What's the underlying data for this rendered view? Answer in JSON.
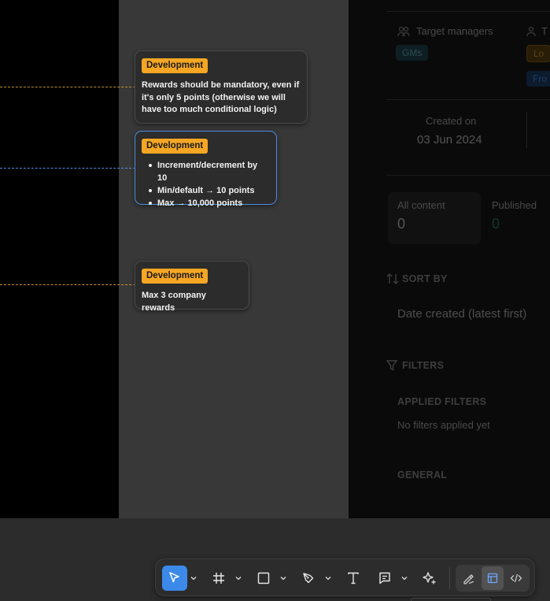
{
  "notes": [
    {
      "tag": "Development",
      "text": "Rewards should be mandatory, even if it's only 5 points (otherwise we will have too much conditional logic)"
    },
    {
      "tag": "Development",
      "bullets": [
        "Increment/decrement by 10",
        "Min/default → 10 points",
        "Max → 10,000 points"
      ]
    },
    {
      "tag": "Development",
      "text": "Max 3 company rewards"
    }
  ],
  "connector_colors": [
    "#c9902c",
    "#4d8fe0",
    "#c9902c"
  ],
  "panel": {
    "target_managers_label": "Target managers",
    "target_managers_chip": "GMs",
    "second_column_cut": "T",
    "chip_lo": "Lo",
    "chip_fro": "Fro",
    "created_on_label": "Created on",
    "created_on_value": "03 Jun 2024",
    "all_content_label": "All content",
    "all_content_value": "0",
    "published_label": "Published",
    "published_value": "0",
    "sort_by_label": "SORT BY",
    "sort_by_value": "Date created (latest first)",
    "filters_label": "FILTERS",
    "applied_filters_label": "APPLIED FILTERS",
    "no_filters_text": "No filters applied yet",
    "general_label": "GENERAL"
  },
  "toolbar": {
    "tools": [
      "move-tool",
      "frame-tool",
      "shape-tool",
      "pen-tool",
      "text-tool",
      "comment-tool",
      "actions-tool"
    ],
    "modes": [
      "draw-mode",
      "design-mode",
      "dev-mode"
    ],
    "accent": "#3b8aea"
  }
}
